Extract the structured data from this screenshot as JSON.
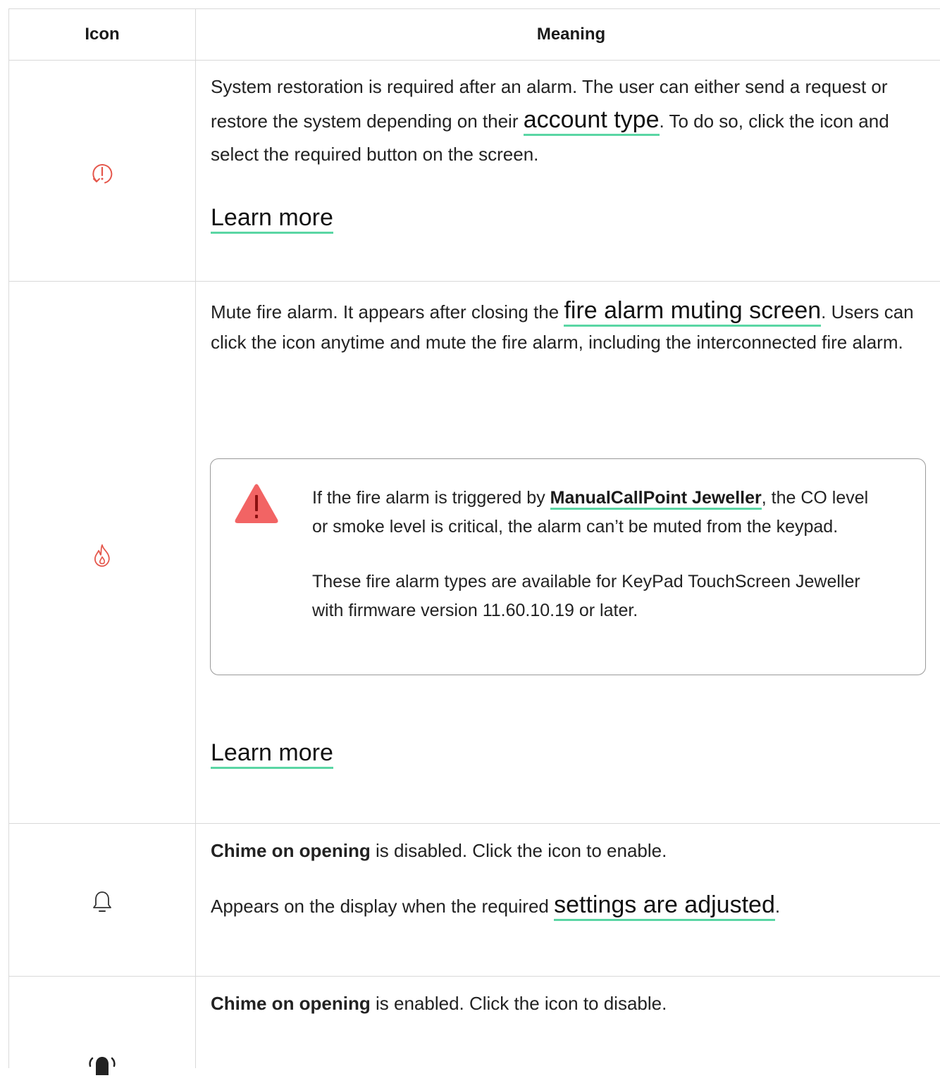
{
  "header": {
    "icon_col": "Icon",
    "meaning_col": "Meaning"
  },
  "rows": [
    {
      "icon": "system-restoration-icon",
      "text_before": "System restoration is required after an alarm. The user can either send a request or restore the system depending on their ",
      "link": "account type",
      "text_after": ". To do so, click the icon and select the required button on the screen.",
      "learn_more": "Learn more"
    },
    {
      "icon": "fire-alarm-mute-icon",
      "text_before": "Mute fire alarm. It appears after closing the ",
      "link": "fire alarm muting screen",
      "text_after": ". Users can click the icon anytime and mute the fire alarm, including the interconnected fire alarm.",
      "warning": {
        "icon": "warning-triangle-icon",
        "p1_before": "If the fire alarm is triggered by ",
        "p1_link": "ManualCallPoint Jeweller",
        "p1_after": ", the CO level or smoke level is critical, the alarm can’t be muted from the keypad.",
        "p2": "These fire alarm types are available for KeyPad TouchScreen Jeweller with firmware version 11.60.10.19 or later."
      },
      "learn_more": "Learn more"
    },
    {
      "icon": "bell-outline-icon",
      "bold": "Chime on opening",
      "text": " is disabled. Click the icon to enable.",
      "p2_before": "Appears on the display when the required ",
      "p2_link": "settings are adjusted",
      "p2_after": "."
    },
    {
      "icon": "bell-ringing-icon",
      "bold": "Chime on opening",
      "text": " is enabled. Click the icon to disable."
    }
  ],
  "colors": {
    "accent_underline": "#5ad6a4",
    "alert_icon": "#e5574c",
    "warning_triangle": "#f26464"
  }
}
